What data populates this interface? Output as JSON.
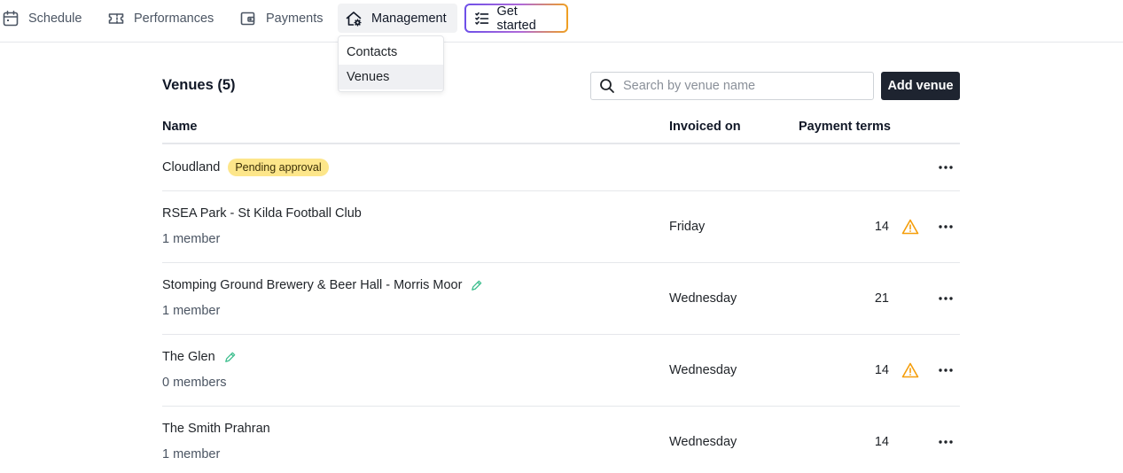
{
  "nav": {
    "schedule": "Schedule",
    "performances": "Performances",
    "payments": "Payments",
    "management": "Management",
    "get_started": "Get started"
  },
  "dropdown": {
    "items": [
      "Contacts",
      "Venues"
    ],
    "active": "Venues"
  },
  "venues": {
    "title": "Venues (5)",
    "search_placeholder": "Search by venue name",
    "add_label": "Add venue",
    "columns": {
      "name": "Name",
      "invoiced_on": "Invoiced on",
      "payment_terms": "Payment terms"
    },
    "rows": [
      {
        "name": "Cloudland",
        "badge": "Pending approval",
        "members": "",
        "invoiced_on": "",
        "payment_terms": "",
        "warning": false,
        "edited": false
      },
      {
        "name": "RSEA Park - St Kilda Football Club",
        "badge": "",
        "members": "1 member",
        "invoiced_on": "Friday",
        "payment_terms": "14",
        "warning": true,
        "edited": false
      },
      {
        "name": "Stomping Ground Brewery & Beer Hall - Morris Moor",
        "badge": "",
        "members": "1 member",
        "invoiced_on": "Wednesday",
        "payment_terms": "21",
        "warning": false,
        "edited": true
      },
      {
        "name": "The Glen",
        "badge": "",
        "members": "0 members",
        "invoiced_on": "Wednesday",
        "payment_terms": "14",
        "warning": true,
        "edited": true
      },
      {
        "name": "The Smith Prahran",
        "badge": "",
        "members": "1 member",
        "invoiced_on": "Wednesday",
        "payment_terms": "14",
        "warning": false,
        "edited": false
      }
    ]
  },
  "colors": {
    "primary_button": "#1e2430",
    "badge_bg": "#fde68a",
    "warning": "#f59e0b",
    "edit_icon": "#3fbf8f"
  }
}
